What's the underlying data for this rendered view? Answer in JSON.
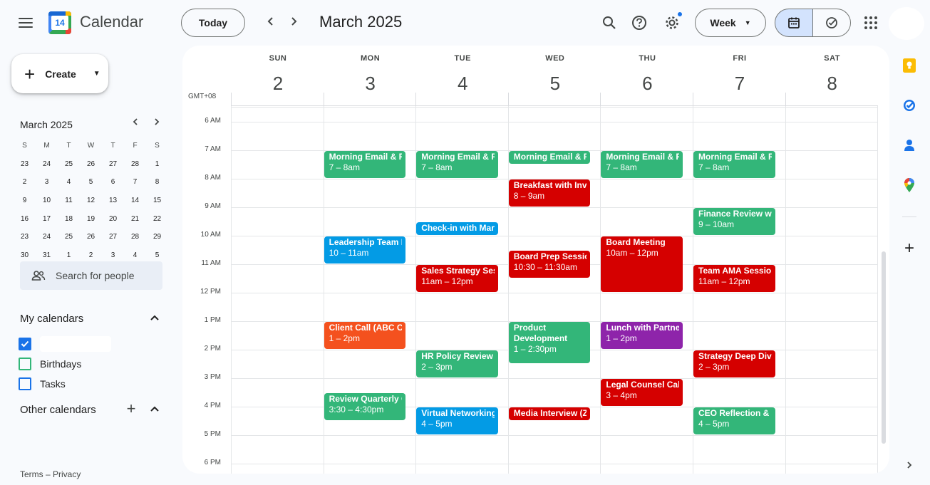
{
  "header": {
    "app_title": "Calendar",
    "logo_day": "14",
    "today_label": "Today",
    "month_title": "March 2025",
    "view_label": "Week"
  },
  "sidebar": {
    "create_label": "Create",
    "mini_cal": {
      "title": "March 2025",
      "weekdays": [
        "S",
        "M",
        "T",
        "W",
        "T",
        "F",
        "S"
      ],
      "weeks": [
        [
          "23",
          "24",
          "25",
          "26",
          "27",
          "28",
          "1"
        ],
        [
          "2",
          "3",
          "4",
          "5",
          "6",
          "7",
          "8"
        ],
        [
          "9",
          "10",
          "11",
          "12",
          "13",
          "14",
          "15"
        ],
        [
          "16",
          "17",
          "18",
          "19",
          "20",
          "21",
          "22"
        ],
        [
          "23",
          "24",
          "25",
          "26",
          "27",
          "28",
          "29"
        ],
        [
          "30",
          "31",
          "1",
          "2",
          "3",
          "4",
          "5"
        ]
      ],
      "selected": "3"
    },
    "search_people_placeholder": "Search for people",
    "my_calendars_title": "My calendars",
    "my_calendars": [
      {
        "name": "",
        "checked": true,
        "color": "#1a73e8"
      },
      {
        "name": "Birthdays",
        "checked": false,
        "color": "#33b679"
      },
      {
        "name": "Tasks",
        "checked": false,
        "color": "#1a73e8"
      }
    ],
    "other_calendars_title": "Other calendars",
    "footer": "Terms – Privacy"
  },
  "week": {
    "timezone": "GMT+08",
    "days": [
      {
        "dow": "SUN",
        "num": "2"
      },
      {
        "dow": "MON",
        "num": "3"
      },
      {
        "dow": "TUE",
        "num": "4"
      },
      {
        "dow": "WED",
        "num": "5"
      },
      {
        "dow": "THU",
        "num": "6"
      },
      {
        "dow": "FRI",
        "num": "7"
      },
      {
        "dow": "SAT",
        "num": "8"
      }
    ],
    "hours": [
      "6 AM",
      "7 AM",
      "8 AM",
      "9 AM",
      "10 AM",
      "11 AM",
      "12 PM",
      "1 PM",
      "2 PM",
      "3 PM",
      "4 PM",
      "5 PM",
      "6 PM"
    ],
    "first_hour": 6
  },
  "colors": {
    "green": "#33b679",
    "red": "#d50000",
    "blue": "#039be5",
    "orange": "#f4511e",
    "purple": "#8e24aa"
  },
  "events": [
    {
      "day": 1,
      "start": 7,
      "end": 8,
      "title": "Morning Email & Re",
      "time": "7 – 8am",
      "color": "green"
    },
    {
      "day": 2,
      "start": 7,
      "end": 8,
      "title": "Morning Email & Re",
      "time": "7 – 8am",
      "color": "green"
    },
    {
      "day": 3,
      "start": 7,
      "end": 7.5,
      "title": "Morning Email & Re",
      "time": "",
      "color": "green"
    },
    {
      "day": 4,
      "start": 7,
      "end": 8,
      "title": "Morning Email & Re",
      "time": "7 – 8am",
      "color": "green"
    },
    {
      "day": 5,
      "start": 7,
      "end": 8,
      "title": "Morning Email & Re",
      "time": "7 – 8am",
      "color": "green"
    },
    {
      "day": 3,
      "start": 8,
      "end": 9,
      "title": "Breakfast with Inves",
      "time": "8 – 9am",
      "color": "red"
    },
    {
      "day": 5,
      "start": 9,
      "end": 10,
      "title": "Finance Review with",
      "time": "9 – 10am",
      "color": "green"
    },
    {
      "day": 2,
      "start": 9.5,
      "end": 10,
      "title": "Check-in with Mark",
      "time": "",
      "color": "blue"
    },
    {
      "day": 1,
      "start": 10,
      "end": 11,
      "title": "Leadership Team M",
      "time": "10 – 11am",
      "color": "blue"
    },
    {
      "day": 4,
      "start": 10,
      "end": 12,
      "title": "Board Meeting",
      "time": "10am – 12pm",
      "color": "red"
    },
    {
      "day": 3,
      "start": 10.5,
      "end": 11.5,
      "title": "Board Prep Session",
      "time": "10:30 – 11:30am",
      "color": "red"
    },
    {
      "day": 2,
      "start": 11,
      "end": 12,
      "title": "Sales Strategy Sess",
      "time": "11am – 12pm",
      "color": "red"
    },
    {
      "day": 5,
      "start": 11,
      "end": 12,
      "title": "Team AMA Session",
      "time": "11am – 12pm",
      "color": "red"
    },
    {
      "day": 1,
      "start": 13,
      "end": 14,
      "title": "Client Call (ABC Co",
      "time": "1 – 2pm",
      "color": "orange"
    },
    {
      "day": 3,
      "start": 13,
      "end": 14.5,
      "title": "Product Development",
      "time": "1 – 2:30pm",
      "color": "green",
      "wrap": true
    },
    {
      "day": 4,
      "start": 13,
      "end": 14,
      "title": "Lunch with Partner",
      "time": "1 – 2pm",
      "color": "purple"
    },
    {
      "day": 2,
      "start": 14,
      "end": 15,
      "title": "HR Policy Review",
      "time": "2 – 3pm",
      "color": "green"
    },
    {
      "day": 5,
      "start": 14,
      "end": 15,
      "title": "Strategy Deep Dive",
      "time": "2 – 3pm",
      "color": "red"
    },
    {
      "day": 4,
      "start": 15,
      "end": 16,
      "title": "Legal Counsel Call",
      "time": "3 – 4pm",
      "color": "red"
    },
    {
      "day": 1,
      "start": 15.5,
      "end": 16.5,
      "title": "Review Quarterly G",
      "time": "3:30 – 4:30pm",
      "color": "green"
    },
    {
      "day": 2,
      "start": 16,
      "end": 17,
      "title": "Virtual Networking",
      "time": "4 – 5pm",
      "color": "blue"
    },
    {
      "day": 3,
      "start": 16,
      "end": 16.5,
      "title": "Media Interview (Zo",
      "time": "",
      "color": "red"
    },
    {
      "day": 5,
      "start": 16,
      "end": 17,
      "title": "CEO Reflection & P",
      "time": "4 – 5pm",
      "color": "green"
    }
  ]
}
